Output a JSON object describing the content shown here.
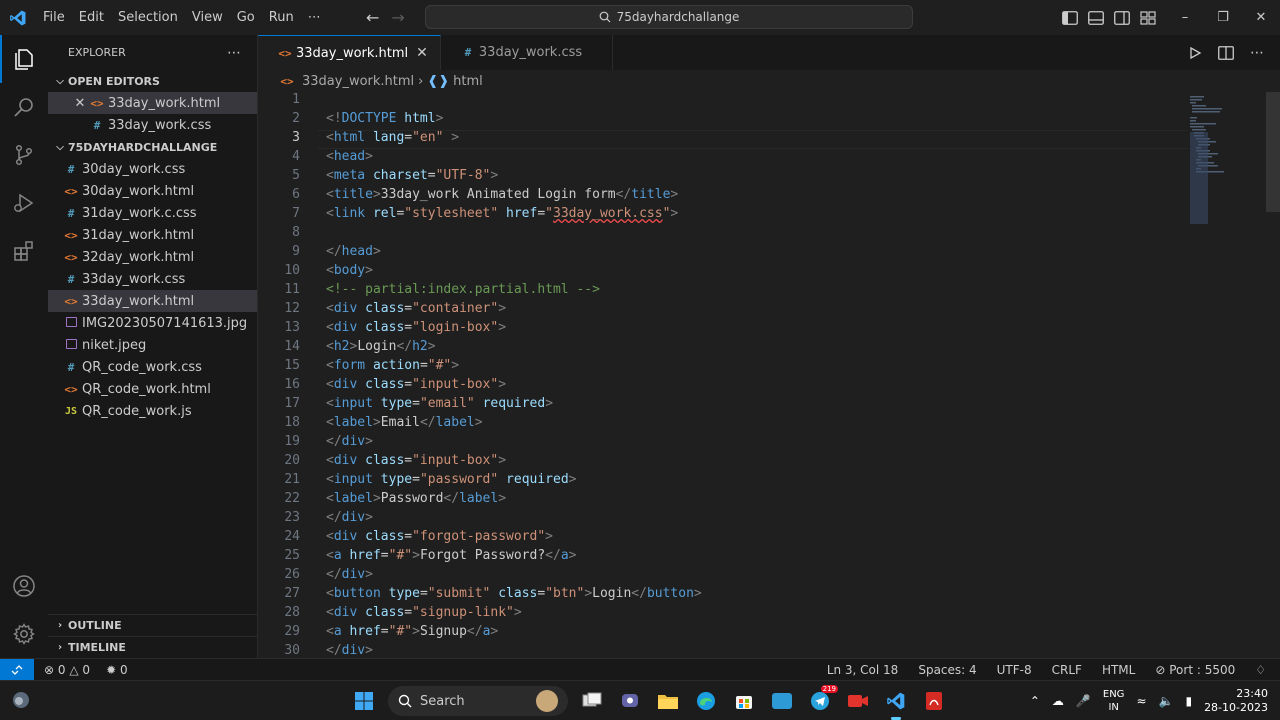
{
  "titlebar": {
    "menu": [
      "File",
      "Edit",
      "Selection",
      "View",
      "Go",
      "Run",
      "⋯"
    ],
    "command_center": "75dayhardchallange"
  },
  "sidebar": {
    "title": "EXPLORER",
    "open_editors_label": "OPEN EDITORS",
    "open_editors": [
      {
        "name": "33day_work.html",
        "type": "html",
        "active": true
      },
      {
        "name": "33day_work.css",
        "type": "css",
        "active": false
      }
    ],
    "folder_label": "75DAYHARDCHALLANGE",
    "files": [
      {
        "name": "30day_work.css",
        "type": "css"
      },
      {
        "name": "30day_work.html",
        "type": "html"
      },
      {
        "name": "31day_work.c.css",
        "type": "css"
      },
      {
        "name": "31day_work.html",
        "type": "html"
      },
      {
        "name": "32day_work.html",
        "type": "html"
      },
      {
        "name": "33day_work.css",
        "type": "css"
      },
      {
        "name": "33day_work.html",
        "type": "html",
        "selected": true
      },
      {
        "name": "IMG20230507141613.jpg",
        "type": "img"
      },
      {
        "name": "niket.jpeg",
        "type": "img"
      },
      {
        "name": "QR_code_work.css",
        "type": "css"
      },
      {
        "name": "QR_code_work.html",
        "type": "html"
      },
      {
        "name": "QR_code_work.js",
        "type": "js"
      }
    ],
    "outline_label": "OUTLINE",
    "timeline_label": "TIMELINE"
  },
  "tabs": [
    {
      "name": "33day_work.html",
      "type": "html",
      "active": true
    },
    {
      "name": "33day_work.css",
      "type": "css",
      "active": false
    }
  ],
  "breadcrumb": {
    "file": "33day_work.html",
    "symbol": "html"
  },
  "editor": {
    "current_line": 3
  },
  "statusbar": {
    "errors": "0",
    "warnings": "0",
    "ports": "0",
    "position": "Ln 3, Col 18",
    "spaces": "Spaces: 4",
    "encoding": "UTF-8",
    "eol": "CRLF",
    "language": "HTML",
    "port": "Port : 5500"
  },
  "taskbar": {
    "search": "Search",
    "lang_top": "ENG",
    "lang_bottom": "IN",
    "time": "23:40",
    "date": "28-10-2023",
    "telegram_badge": "219"
  },
  "colors": {
    "accent": "#0078d4",
    "html_icon": "#e37933",
    "css_icon": "#519aba",
    "js_icon": "#cbcb41"
  }
}
